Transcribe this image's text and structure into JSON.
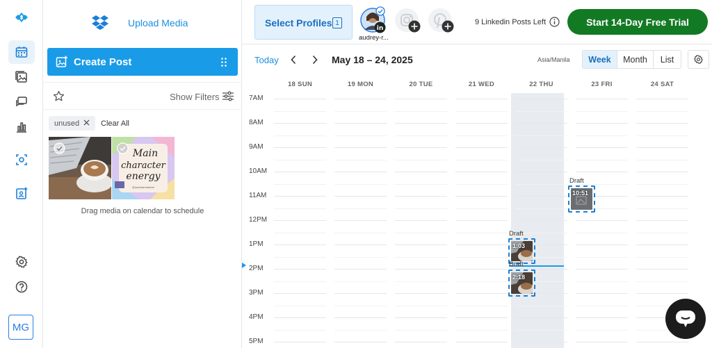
{
  "rail": {
    "icons": [
      "logo-icon",
      "calendar-icon",
      "media-library-icon",
      "messages-icon",
      "analytics-icon",
      "listening-icon",
      "ai-assistant-icon",
      "settings-icon",
      "help-icon"
    ],
    "avatar_initials": "MG",
    "accent": "#2a7de1"
  },
  "media_panel": {
    "upload_label": "Upload Media",
    "create_post_label": "Create Post",
    "show_filters_label": "Show Filters",
    "chip_label": "unused",
    "clear_all_label": "Clear All",
    "thumbnails": [
      {
        "name": "coffee-laptop-photo"
      },
      {
        "name": "main-character-energy-graphic",
        "text": "Main character energy",
        "credit": "@yourbrandname"
      }
    ],
    "drag_hint": "Drag media on calendar to schedule"
  },
  "topbar": {
    "select_profiles_label": "Select Profiles",
    "selected_count": "1",
    "profiles": [
      {
        "name": "audrey-r...",
        "network": "linkedin",
        "selected": true
      },
      {
        "name": "",
        "network": "instagram",
        "selected": false
      },
      {
        "name": "",
        "network": "pinterest",
        "selected": false
      }
    ],
    "posts_left": "9 Linkedin Posts Left",
    "trial_label": "Start 14-Day Free Trial",
    "trial_color": "#137a24"
  },
  "calendar": {
    "today_label": "Today",
    "date_range": "May 18 – 24, 2025",
    "timezone": "Asia/Manila",
    "views": [
      "Week",
      "Month",
      "List"
    ],
    "active_view": "Week",
    "days": [
      "18 SUN",
      "19 MON",
      "20 TUE",
      "21 WED",
      "22 THU",
      "23 FRI",
      "24 SAT"
    ],
    "today_index": 4,
    "hours": [
      "7AM",
      "8AM",
      "9AM",
      "10AM",
      "11AM",
      "12PM",
      "1PM",
      "2PM",
      "3PM",
      "4PM",
      "5PM"
    ],
    "events": [
      {
        "label": "Draft",
        "time": "10:51",
        "day": "23 FRI"
      },
      {
        "label": "Draft",
        "time": "1:03",
        "day": "22 THU"
      },
      {
        "label": "Draft",
        "time": "2:18",
        "day": "22 THU"
      }
    ],
    "accent": "#1a9be8"
  }
}
